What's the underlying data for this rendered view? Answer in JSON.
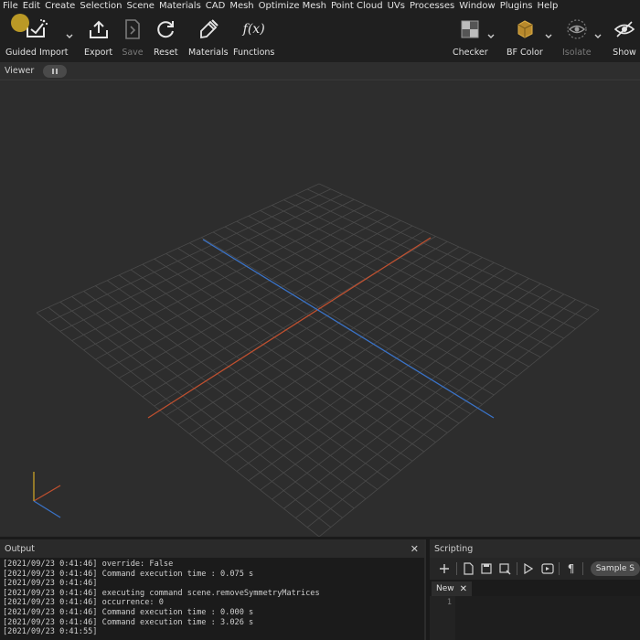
{
  "menu": [
    "File",
    "Edit",
    "Create",
    "Selection",
    "Scene",
    "Materials",
    "CAD",
    "Mesh",
    "Optimize Mesh",
    "Point Cloud",
    "UVs",
    "Processes",
    "Window",
    "Plugins",
    "Help"
  ],
  "toolbar": {
    "guided_import": "Guided Import",
    "export": "Export",
    "save": "Save",
    "reset": "Reset",
    "materials": "Materials",
    "functions": "Functions",
    "functions_glyph": "f(x)",
    "checker": "Checker",
    "bf_color": "BF Color",
    "isolate": "Isolate",
    "show": "Show"
  },
  "viewer": {
    "title": "Viewer"
  },
  "output": {
    "title": "Output",
    "close": "✕",
    "lines": [
      "[2021/09/23 0:41:46] override: False",
      "[2021/09/23 0:41:46] Command execution time : 0.075 s",
      "[2021/09/23 0:41:46]",
      "[2021/09/23 0:41:46] executing command scene.removeSymmetryMatrices",
      "[2021/09/23 0:41:46] occurrence: 0",
      "[2021/09/23 0:41:46] Command execution time : 0.000 s",
      "[2021/09/23 0:41:46] Command execution time : 3.026 s",
      "[2021/09/23 0:41:55]"
    ]
  },
  "scripting": {
    "title": "Scripting",
    "sample_button": "Sample S",
    "tab_new": "New",
    "tab_close": "✕",
    "line_number": "1"
  },
  "colors": {
    "axis_x": "#c0502f",
    "axis_z": "#3a73c8",
    "axis_y": "#c9a227",
    "grid": "#4a4a4a",
    "cursor": "#d6af28"
  }
}
